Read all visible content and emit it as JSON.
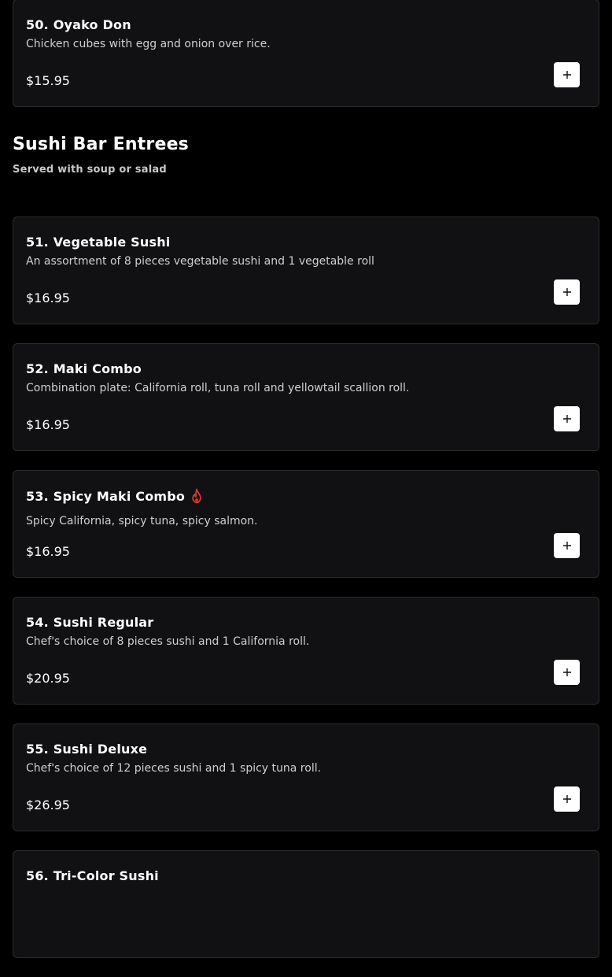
{
  "items_top": [
    {
      "name": "50. Oyako Don",
      "description": "Chicken cubes with egg and onion over rice.",
      "price": "$15.95"
    }
  ],
  "section": {
    "title": "Sushi Bar Entrees",
    "subtitle": "Served with soup or salad"
  },
  "items": [
    {
      "name": "51. Vegetable Sushi",
      "description": "An assortment of 8 pieces vegetable sushi and 1 vegetable roll",
      "price": "$16.95"
    },
    {
      "name": "52. Maki Combo",
      "description": "Combination plate: California roll, tuna roll and yellowtail scallion roll.",
      "price": "$16.95"
    },
    {
      "name": "53. Spicy Maki Combo",
      "description": "Spicy California, spicy tuna, spicy salmon.",
      "price": "$16.95",
      "icon": "spicy-flame-icon"
    },
    {
      "name": "54. Sushi Regular",
      "description": "Chef's choice of 8 pieces sushi and 1 California roll.",
      "price": "$20.95"
    },
    {
      "name": "55. Sushi Deluxe",
      "description": "Chef's choice of 12 pieces sushi and 1 spicy tuna roll.",
      "price": "$26.95"
    },
    {
      "name": "56. Tri-Color Sushi"
    }
  ],
  "colors": {
    "background": "#000000",
    "card": "#111113",
    "card_border": "#2c2c2f",
    "accent_flame": "#e03a2c",
    "button": "#ffffff"
  }
}
